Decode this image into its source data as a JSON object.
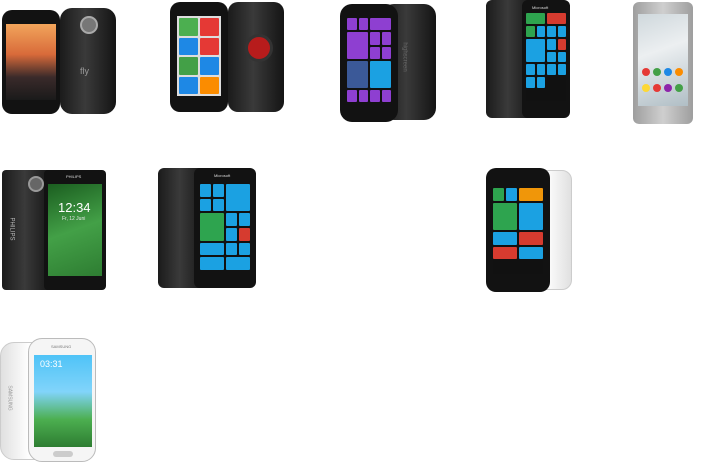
{
  "phones": [
    {
      "brand_mark": "fly"
    },
    {
      "brand_mark": ""
    },
    {
      "brand_mark": "highscreen"
    },
    {
      "brand_mark": "Microsoft"
    },
    {
      "brand_mark": ""
    },
    {
      "brand_mark": "PHILIPS",
      "clock": "12:34",
      "date": "Fr, 12 Juni"
    },
    {
      "brand_mark": "Microsoft"
    },
    {
      "brand_mark": ""
    },
    {
      "brand_mark": "SAMSUNG",
      "clock": "03:31"
    }
  ],
  "colors": {
    "wp_blue": "#1ba1e2",
    "wp_green": "#2ea44f",
    "wp_red": "#d63b2f",
    "wp_purple": "#8e3fd1",
    "wp_orange": "#f09609",
    "philips_screen": "#2e7d32",
    "samsung_body": "#eeeeee"
  }
}
